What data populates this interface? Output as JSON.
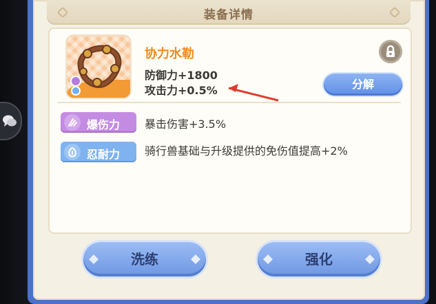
{
  "title": "装备详情",
  "item": {
    "name": "协力水勒",
    "stats": [
      "防御力+1800",
      "攻击力+0.5%"
    ]
  },
  "buttons": {
    "decompose": "分解",
    "refine": "洗练",
    "strengthen": "强化"
  },
  "skills": [
    {
      "name": "爆伤力",
      "description": "暴击伤害+3.5%",
      "color": "#c48be3"
    },
    {
      "name": "忍耐力",
      "description": "骑行兽基础与升级提供的免伤值提高+2%",
      "color": "#7fb3ef"
    }
  ],
  "colors": {
    "frame_blue": "#4b71c9",
    "item_name_orange": "#f08a1e",
    "annotation_arrow": "#e03a2b"
  },
  "icons": [
    "chat-icon",
    "lock-icon",
    "harness-item-icon",
    "crit-skill-icon",
    "endurance-skill-icon",
    "red-arrow-icon"
  ]
}
